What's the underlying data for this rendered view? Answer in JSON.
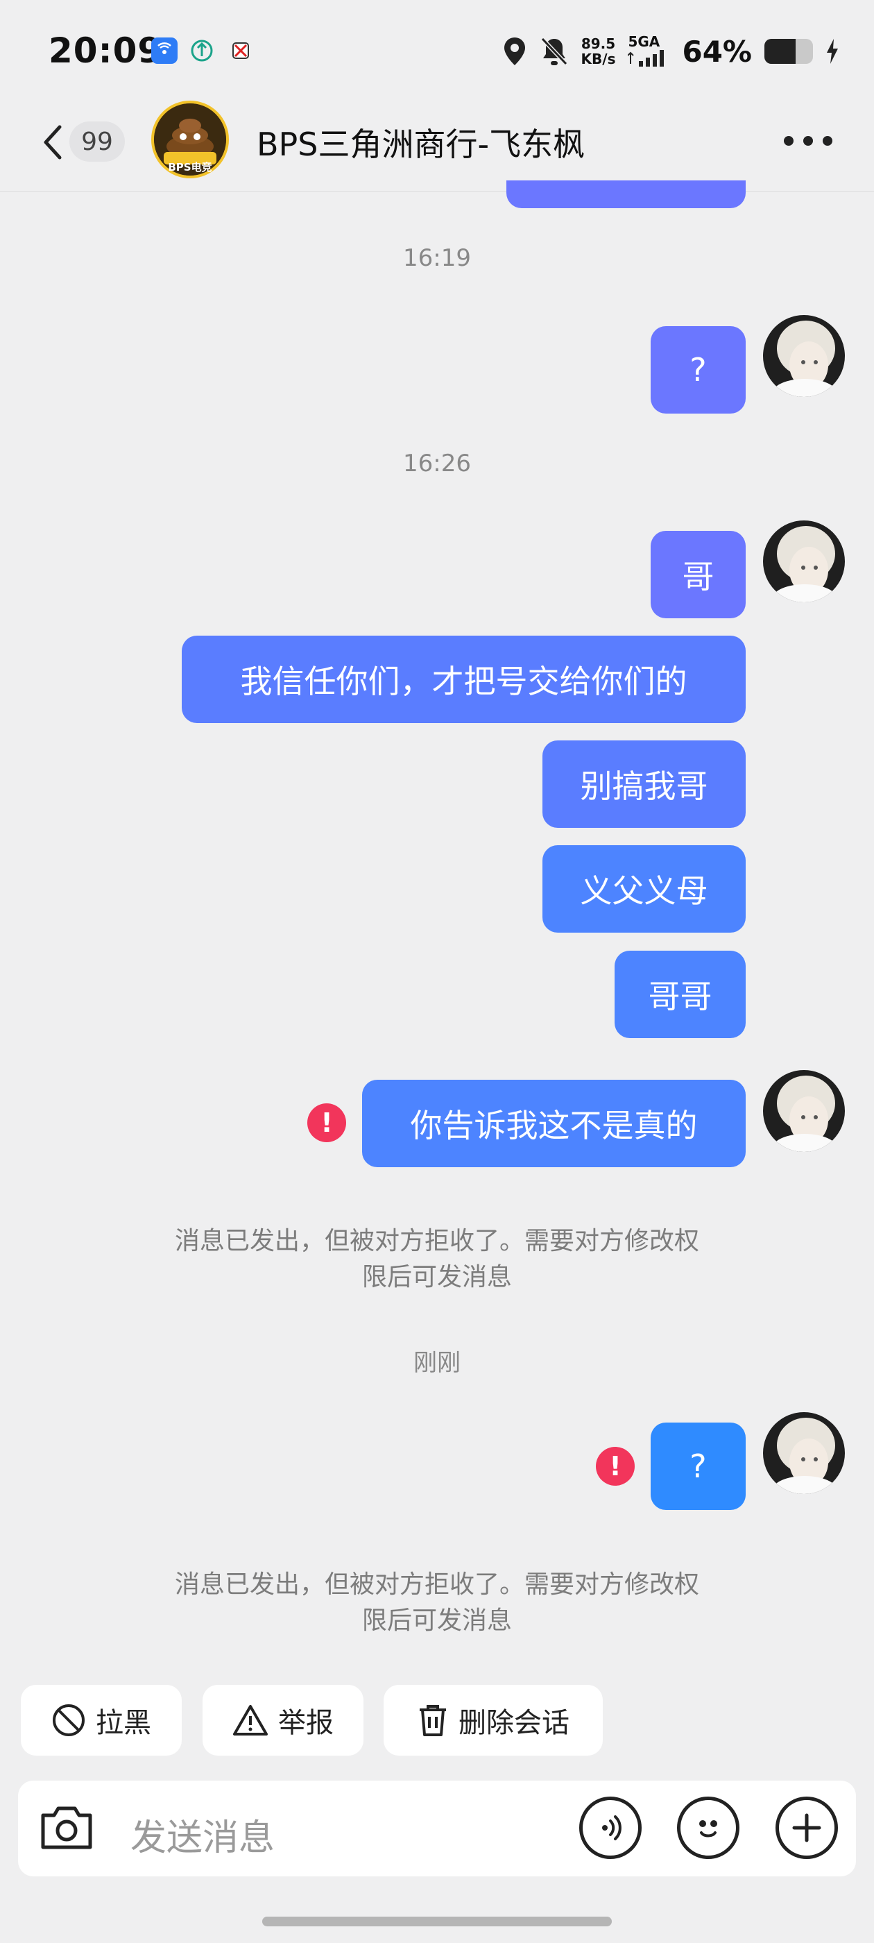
{
  "status_bar": {
    "time": "20:09",
    "app_icons": [
      "signal-app-icon",
      "recycle-icon",
      "game-icon"
    ],
    "net_speed_value": "89.5",
    "net_speed_unit": "KB/s",
    "network": "5GA",
    "battery_percent": "64%",
    "battery_level": 0.64
  },
  "header": {
    "unread_count": "99",
    "title": "BPS三角洲商行-飞东枫",
    "avatar_text": "BPS电竞"
  },
  "chat": {
    "timestamp_1": "16:19",
    "msg_1": "?",
    "timestamp_2": "16:26",
    "msg_2": "哥",
    "msg_3": "我信任你们，才把号交给你们的",
    "msg_4": "别搞我哥",
    "msg_5": "义父义母",
    "msg_6": "哥哥",
    "msg_7": "你告诉我这不是真的",
    "error_mark": "!",
    "notice_1_line1": "消息已发出，但被对方拒收了。需要对方修改权",
    "notice_1_line2": "限后可发消息",
    "timestamp_3": "刚刚",
    "msg_8": "?",
    "notice_2_line1": "消息已发出，但被对方拒收了。需要对方修改权",
    "notice_2_line2": "限后可发消息"
  },
  "actions": {
    "block": "拉黑",
    "report": "举报",
    "delete": "删除会话"
  },
  "input": {
    "placeholder": "发送消息"
  },
  "colors": {
    "bubble_purple": "#6b77ff",
    "bubble_blue": "#4d84ff",
    "error_red": "#f2355b",
    "background": "#efeff0"
  }
}
